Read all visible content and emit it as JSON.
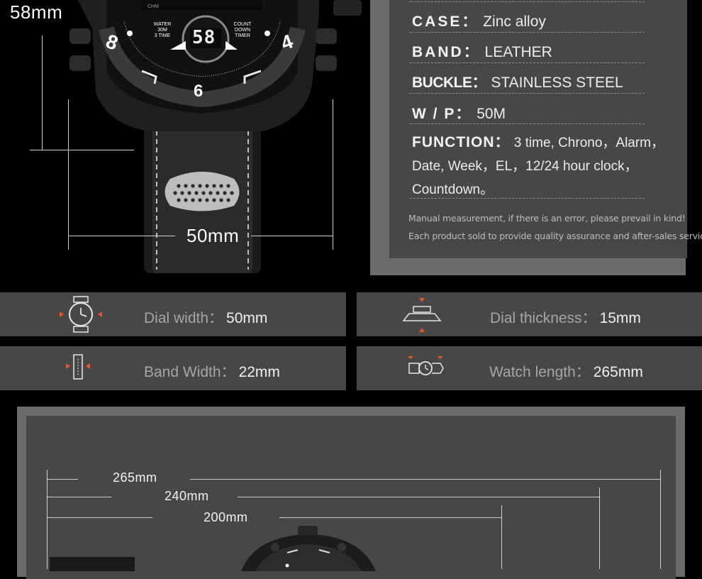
{
  "watch_top": {
    "height_label": "58mm",
    "width_label": "50mm",
    "dial_text": {
      "water": "WATER",
      "water_depth": "30M",
      "three_time": "3 TIME",
      "chm": "CHM",
      "count": "COUNT",
      "down": "DOWN",
      "timer": "TIMER",
      "digital": "58",
      "numeral_six": "6",
      "numeral_four": "4",
      "numeral_eight": "8"
    }
  },
  "specs": {
    "rows": [
      {
        "label": "CASE",
        "value": "Zinc alloy"
      },
      {
        "label": "BAND",
        "value": "LEATHER"
      },
      {
        "label": "BUCKLE",
        "value": "STAINLESS STEEL"
      },
      {
        "label": "W / P",
        "value": "50M"
      }
    ],
    "function_label": "FUNCTION",
    "function_value": "3 time, Chrono，Alarm，Date, Week，EL，12/24 hour clock，Countdown。",
    "note_line1": "Manual measurement, if there is an error, please prevail in kind!",
    "note_line2": "Each product sold to provide quality assurance and after-sales service!"
  },
  "info_bars": [
    {
      "label": "Dial width：",
      "value": "50mm",
      "icon": "watch-dial-width-icon"
    },
    {
      "label": "Dial thickness：",
      "value": "15mm",
      "icon": "watch-thickness-icon"
    },
    {
      "label": "Band Width：",
      "value": "22mm",
      "icon": "band-width-icon"
    },
    {
      "label": "Watch length：",
      "value": "265mm",
      "icon": "watch-length-icon"
    }
  ],
  "length_dims": {
    "total": "265mm",
    "mid": "240mm",
    "short": "200mm"
  },
  "colors": {
    "accent": "#e2572a",
    "panel": "#474747",
    "frame": "#6b6b6b"
  }
}
